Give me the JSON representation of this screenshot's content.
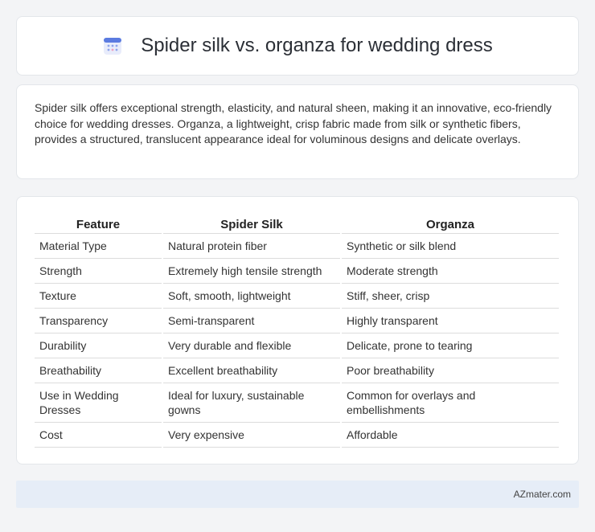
{
  "header": {
    "title": "Spider silk vs. organza for wedding dress",
    "icon": "calendar-icon",
    "accent_color": "#5b7be0"
  },
  "intro": {
    "text": "Spider silk offers exceptional strength, elasticity, and natural sheen, making it an innovative, eco-friendly choice for wedding dresses. Organza, a lightweight, crisp fabric made from silk or synthetic fibers, provides a structured, translucent appearance ideal for voluminous designs and delicate overlays."
  },
  "table": {
    "headers": [
      "Feature",
      "Spider Silk",
      "Organza"
    ],
    "rows": [
      [
        "Material Type",
        "Natural protein fiber",
        "Synthetic or silk blend"
      ],
      [
        "Strength",
        "Extremely high tensile strength",
        "Moderate strength"
      ],
      [
        "Texture",
        "Soft, smooth, lightweight",
        "Stiff, sheer, crisp"
      ],
      [
        "Transparency",
        "Semi-transparent",
        "Highly transparent"
      ],
      [
        "Durability",
        "Very durable and flexible",
        "Delicate, prone to tearing"
      ],
      [
        "Breathability",
        "Excellent breathability",
        "Poor breathability"
      ],
      [
        "Use in Wedding Dresses",
        "Ideal for luxury, sustainable gowns",
        "Common for overlays and embellishments"
      ],
      [
        "Cost",
        "Very expensive",
        "Affordable"
      ]
    ]
  },
  "footer": {
    "brand": "AZmater.com"
  }
}
